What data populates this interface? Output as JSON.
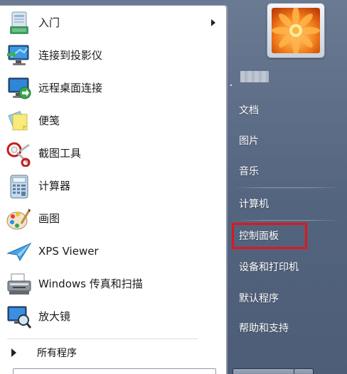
{
  "programs": [
    {
      "label": "入门",
      "icon": "getting-started-icon",
      "has_submenu": true
    },
    {
      "label": "连接到投影仪",
      "icon": "projector-icon",
      "has_submenu": false
    },
    {
      "label": "远程桌面连接",
      "icon": "remote-desktop-icon",
      "has_submenu": false
    },
    {
      "label": "便笺",
      "icon": "sticky-notes-icon",
      "has_submenu": false
    },
    {
      "label": "截图工具",
      "icon": "snipping-tool-icon",
      "has_submenu": false
    },
    {
      "label": "计算器",
      "icon": "calculator-icon",
      "has_submenu": false
    },
    {
      "label": "画图",
      "icon": "paint-icon",
      "has_submenu": false
    },
    {
      "label": "XPS Viewer",
      "icon": "xps-viewer-icon",
      "has_submenu": false
    },
    {
      "label": "Windows 传真和扫描",
      "icon": "fax-scan-icon",
      "has_submenu": false
    },
    {
      "label": "放大镜",
      "icon": "magnifier-icon",
      "has_submenu": false
    }
  ],
  "all_programs": {
    "label": "所有程序",
    "icon": "expand-arrow-icon"
  },
  "right_items": [
    {
      "label": "文档"
    },
    {
      "label": "图片"
    },
    {
      "label": "音乐"
    },
    {
      "label": "计算机"
    },
    {
      "label": "控制面板",
      "highlighted": true
    },
    {
      "label": "设备和打印机"
    },
    {
      "label": "默认程序"
    },
    {
      "label": "帮助和支持"
    }
  ],
  "colors": {
    "highlight_border": "#e0161d",
    "menu_text": "#1a1a1a",
    "right_text": "#ffffff"
  }
}
